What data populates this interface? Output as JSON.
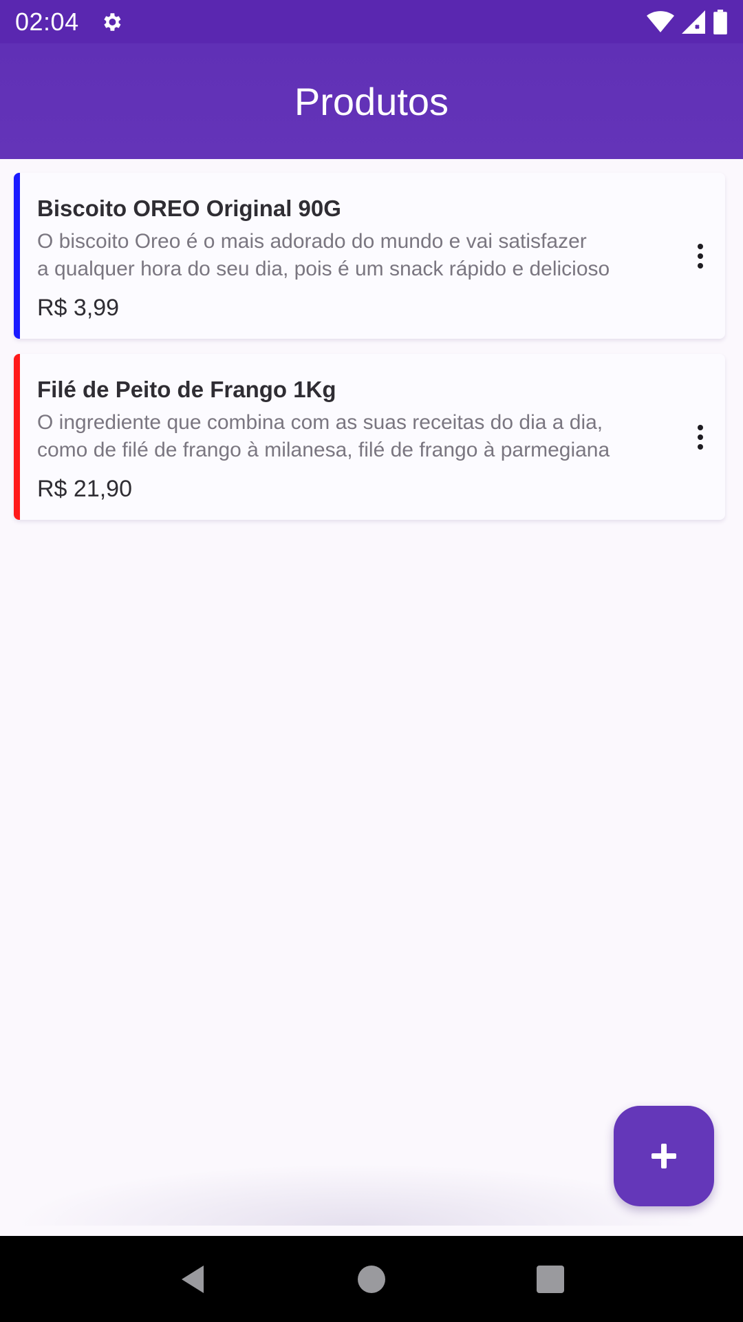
{
  "status_bar": {
    "time": "02:04",
    "icons": [
      "gear-icon",
      "wifi-icon",
      "signal-icon",
      "battery-icon"
    ]
  },
  "app_bar": {
    "title": "Produtos"
  },
  "products": [
    {
      "name": "Biscoito OREO Original 90G",
      "description_line1": "O biscoito Oreo é o mais adorado do mundo e vai satisfazer",
      "description_line2": "a qualquer hora do seu dia, pois é um snack rápido e delicioso",
      "price": "R$ 3,99",
      "accent_color": "#1a1aff",
      "menu_icon": "more-vert-icon"
    },
    {
      "name": "Filé de Peito de Frango 1Kg",
      "description_line1": "O ingrediente que combina com as suas receitas do dia a dia,",
      "description_line2": "como de filé de frango à milanesa, filé de frango à parmegiana",
      "price": "R$ 21,90",
      "accent_color": "#ff1a1a",
      "menu_icon": "more-vert-icon"
    }
  ],
  "fab": {
    "icon": "plus-icon",
    "color": "#6437b9"
  },
  "nav_bar": {
    "icons": [
      "back-icon",
      "home-icon",
      "recents-icon"
    ]
  },
  "colors": {
    "primary": "#6434b8",
    "status_bar": "#5a27b0",
    "background": "#fbf8fd"
  }
}
